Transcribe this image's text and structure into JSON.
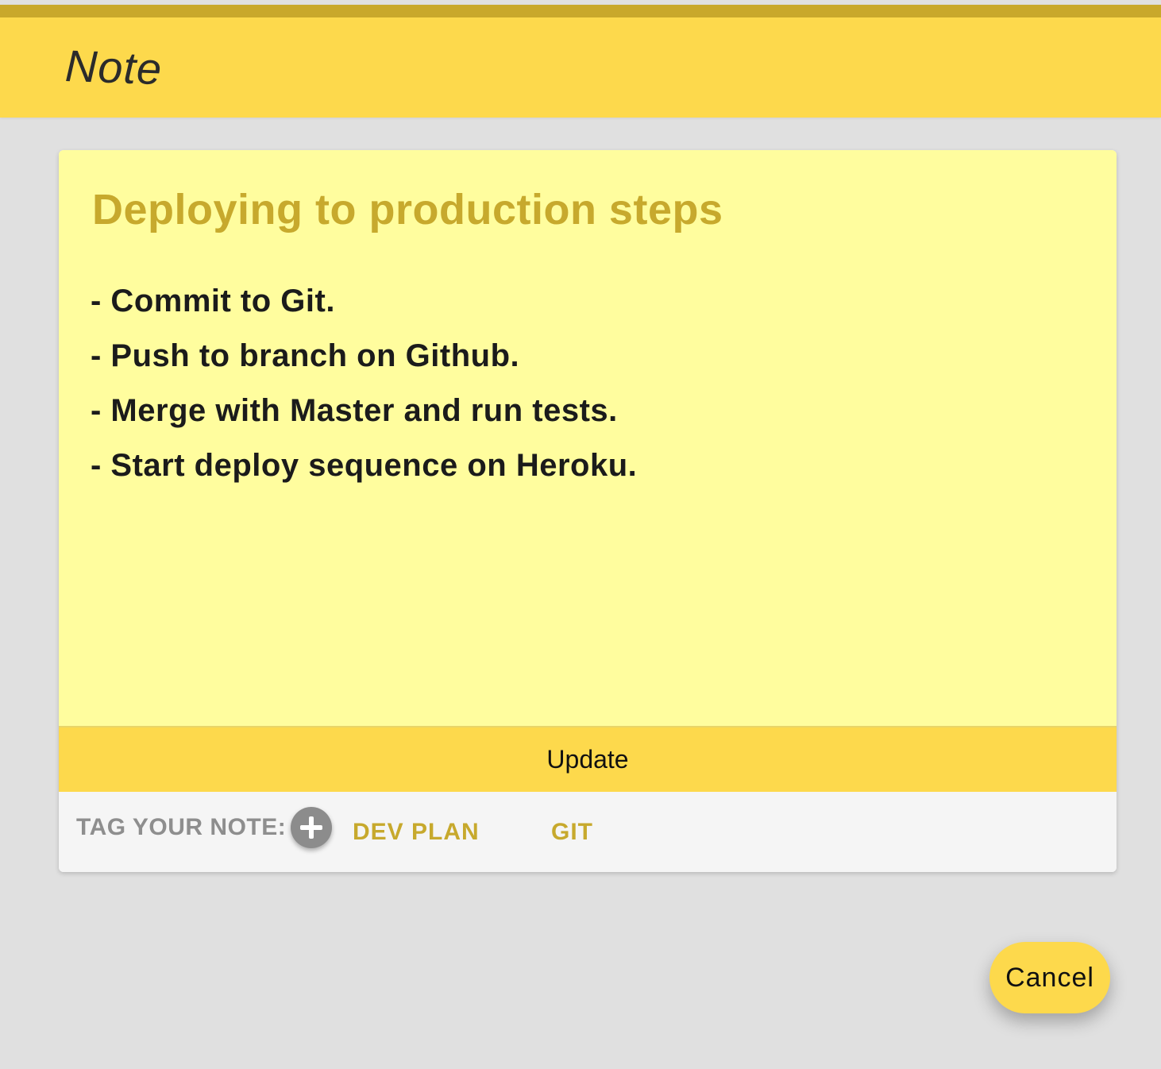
{
  "app_bar": {
    "title": "Note"
  },
  "note": {
    "title": "Deploying to production steps",
    "body_lines": [
      "- Commit to Git.",
      "- Push to branch on Github.",
      "- Merge with Master and run tests.",
      "- Start deploy sequence on Heroku."
    ],
    "update_label": "Update"
  },
  "tags": {
    "label": "TAG YOUR NOTE:",
    "add_icon": "plus-icon",
    "items": [
      "DEV PLAN",
      "GIT"
    ]
  },
  "actions": {
    "cancel_label": "Cancel"
  },
  "colors": {
    "accent": "#fdd94c",
    "note_background": "#fffd9e",
    "title_color": "#c7a92d",
    "page_background": "#e0e0e0"
  }
}
